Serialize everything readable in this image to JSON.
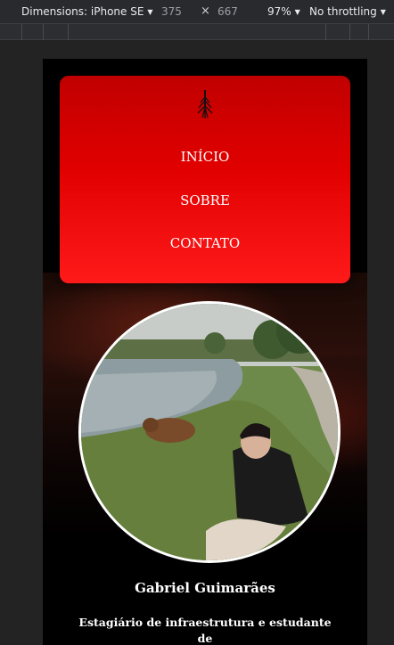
{
  "devtools": {
    "dimensions_label": "Dimensions: iPhone SE",
    "width": "375",
    "times": "×",
    "height": "667",
    "zoom": "97%",
    "throttling": "No throttling"
  },
  "nav": {
    "items": [
      {
        "label": "INÍCIO"
      },
      {
        "label": "SOBRE"
      },
      {
        "label": "CONTATO"
      }
    ]
  },
  "profile": {
    "name": "Gabriel Guimarães",
    "bio": "Estagiário de infraestrutura e estudante de"
  },
  "colors": {
    "nav_card": "#e10000",
    "page_background": "#000000",
    "devtools_background": "#292a2d"
  }
}
